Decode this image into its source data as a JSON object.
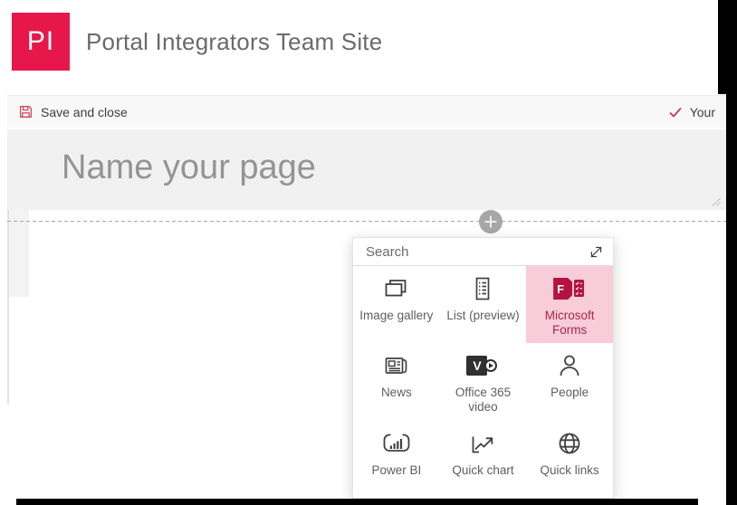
{
  "header": {
    "logo_text": "PI",
    "site_title": "Portal Integrators Team Site"
  },
  "toolbar": {
    "save_label": "Save and close",
    "status_label": "Your"
  },
  "page": {
    "title_placeholder": "Name your page"
  },
  "webpart_picker": {
    "search_placeholder": "Search",
    "items": [
      {
        "label": "Image gallery",
        "icon": "image-gallery-icon",
        "selected": false
      },
      {
        "label": "List (preview)",
        "icon": "list-icon",
        "selected": false
      },
      {
        "label": "Microsoft Forms",
        "icon": "forms-icon",
        "selected": true
      },
      {
        "label": "News",
        "icon": "news-icon",
        "selected": false
      },
      {
        "label": "Office 365 video",
        "icon": "video-icon",
        "selected": false
      },
      {
        "label": "People",
        "icon": "people-icon",
        "selected": false
      },
      {
        "label": "Power BI",
        "icon": "powerbi-icon",
        "selected": false
      },
      {
        "label": "Quick chart",
        "icon": "quick-chart-icon",
        "selected": false
      },
      {
        "label": "Quick links",
        "icon": "quick-links-icon",
        "selected": false
      }
    ]
  },
  "colors": {
    "logo_bg": "#E8174B",
    "toolbar_accent": "#CE4760",
    "selected_tile_bg": "#F8CCD8",
    "selected_tile_text": "#A52A4E",
    "forms_brand": "#B5123F",
    "icon_gray": "#404040",
    "label_gray": "#5E5E5E",
    "title_area_bg": "#F1F1F1"
  }
}
